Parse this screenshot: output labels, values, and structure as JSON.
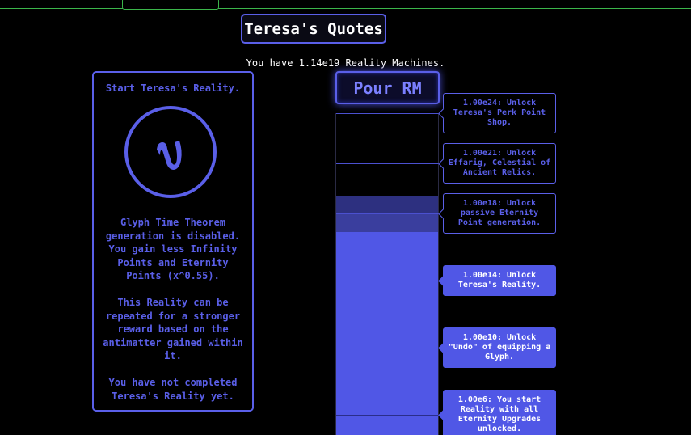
{
  "quotes_button": "Teresa's Quotes",
  "reality_machines_text": "You have 1.14e19 Reality Machines.",
  "reality_panel": {
    "start_label": "Start Teresa's Reality.",
    "symbol": "ϰ",
    "description_1": "Glyph Time Theorem generation is disabled. You gain less Infinity Points and Eternity Points (x^0.55).",
    "description_2": "This Reality can be repeated for a stronger reward based on the antimatter gained within it.",
    "description_3": "You have not completed Teresa's Reality yet."
  },
  "pour_button": "Pour RM",
  "unlocks": [
    {
      "text": "1.00e24: Unlock Teresa's Perk Point Shop.",
      "state": "locked"
    },
    {
      "text": "1.00e21: Unlock Effarig, Celestial of Ancient Relics.",
      "state": "locked"
    },
    {
      "text": "1.00e18: Unlock passive Eternity Point generation.",
      "state": "locked"
    },
    {
      "text": "1.00e14: Unlock Teresa's Reality.",
      "state": "unlocked"
    },
    {
      "text": "1.00e10: Unlock \"Undo\" of equipping a Glyph.",
      "state": "unlocked"
    },
    {
      "text": "1.00e6: You start Reality with all Eternity Upgrades unlocked.",
      "state": "unlocked"
    }
  ],
  "colors": {
    "accent": "#5a5fe8",
    "fill": "#5057e6",
    "tab_line": "#3bb54a",
    "background": "#000000"
  }
}
